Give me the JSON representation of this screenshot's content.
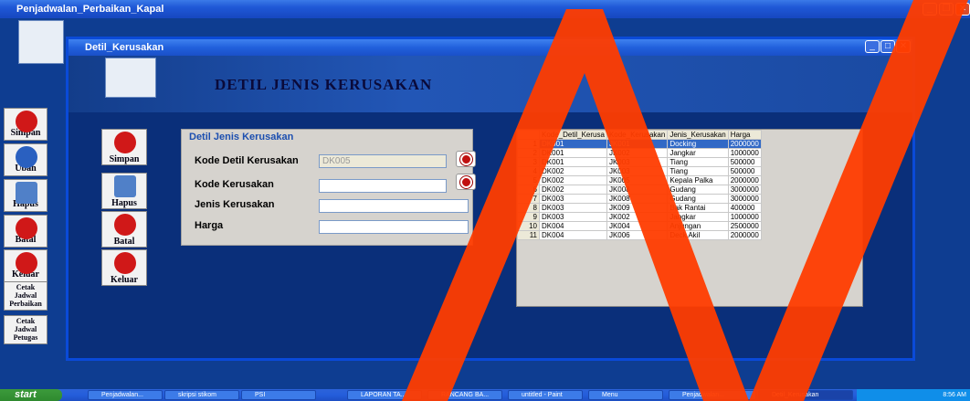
{
  "outer_window": {
    "title": "Penjadwalan_Perbaikan_Kapal"
  },
  "inner_window": {
    "title": "Detil_Kerusakan"
  },
  "banner": {
    "title": "DETIL JENIS KERUSAKAN"
  },
  "sidebar": {
    "items": [
      {
        "label": "Simpan",
        "icon": "save-icon",
        "color": "#d01818"
      },
      {
        "label": "Ubah",
        "icon": "refresh-icon",
        "color": "#2a60c0"
      },
      {
        "label": "Hapus",
        "icon": "trash-icon",
        "color": "#5080c8"
      },
      {
        "label": "Batal",
        "icon": "cancel-icon",
        "color": "#d01818"
      },
      {
        "label": "Keluar",
        "icon": "power-icon",
        "color": "#d01818"
      },
      {
        "label": "Cetak Jadwal Perbaikan",
        "icon": "print-icon"
      },
      {
        "label": "Cetak Jadwal Petugas",
        "icon": "print-icon"
      }
    ]
  },
  "form_buttons": [
    {
      "label": "Simpan"
    },
    {
      "label": "Hapus"
    },
    {
      "label": "Batal"
    },
    {
      "label": "Keluar"
    }
  ],
  "form": {
    "group_title": "Detil Jenis Kerusakan",
    "kode_detil_label": "Kode Detil Kerusakan",
    "kode_detil_value": "DK005",
    "kode_kerusakan_label": "Kode Kerusakan",
    "kode_kerusakan_value": "",
    "jenis_label": "Jenis Kerusakan",
    "jenis_value": "",
    "harga_label": "Harga",
    "harga_value": ""
  },
  "grid": {
    "columns": [
      "Kode_Detil_Kerusa",
      "Kode_Kerusakan",
      "Jenis_Kerusakan",
      "Harga"
    ],
    "rows": [
      {
        "n": "1",
        "kode_detil": "DK001",
        "kode_kerusakan": "JK001",
        "jenis": "Docking",
        "harga": "2000000"
      },
      {
        "n": "2",
        "kode_detil": "DK001",
        "kode_kerusakan": "JK002",
        "jenis": "Jangkar",
        "harga": "1000000"
      },
      {
        "n": "3",
        "kode_detil": "DK001",
        "kode_kerusakan": "JK003",
        "jenis": "Tiang",
        "harga": "500000"
      },
      {
        "n": "4",
        "kode_detil": "DK002",
        "kode_kerusakan": "JK003",
        "jenis": "Tiang",
        "harga": "500000"
      },
      {
        "n": "5",
        "kode_detil": "DK002",
        "kode_kerusakan": "JK005",
        "jenis": "Kepala Palka",
        "harga": "2000000"
      },
      {
        "n": "6",
        "kode_detil": "DK002",
        "kode_kerusakan": "JK008",
        "jenis": "Gudang",
        "harga": "3000000"
      },
      {
        "n": "7",
        "kode_detil": "DK003",
        "kode_kerusakan": "JK008",
        "jenis": "Gudang",
        "harga": "3000000"
      },
      {
        "n": "8",
        "kode_detil": "DK003",
        "kode_kerusakan": "JK009",
        "jenis": "Bak Rantai",
        "harga": "400000"
      },
      {
        "n": "9",
        "kode_detil": "DK003",
        "kode_kerusakan": "JK002",
        "jenis": "Jangkar",
        "harga": "1000000"
      },
      {
        "n": "10",
        "kode_detil": "DK004",
        "kode_kerusakan": "JK004",
        "jenis": "Anjungan",
        "harga": "2500000"
      },
      {
        "n": "11",
        "kode_detil": "DK004",
        "kode_kerusakan": "JK006",
        "jenis": "Deck Akil",
        "harga": "2000000"
      }
    ]
  },
  "taskbar": {
    "start_label": "start",
    "tasks": [
      "Penjadwalan...",
      "skripsi stikom",
      "PSI",
      "LAPORAN TA...",
      "RANCANG BA...",
      "untitled - Paint",
      "Menu",
      "Penjadwalan...",
      "Detil_Kerusakan"
    ],
    "clock": "8:56 AM"
  },
  "colors": {
    "watermark": "#ff3c00",
    "accent": "#1f58d6"
  }
}
